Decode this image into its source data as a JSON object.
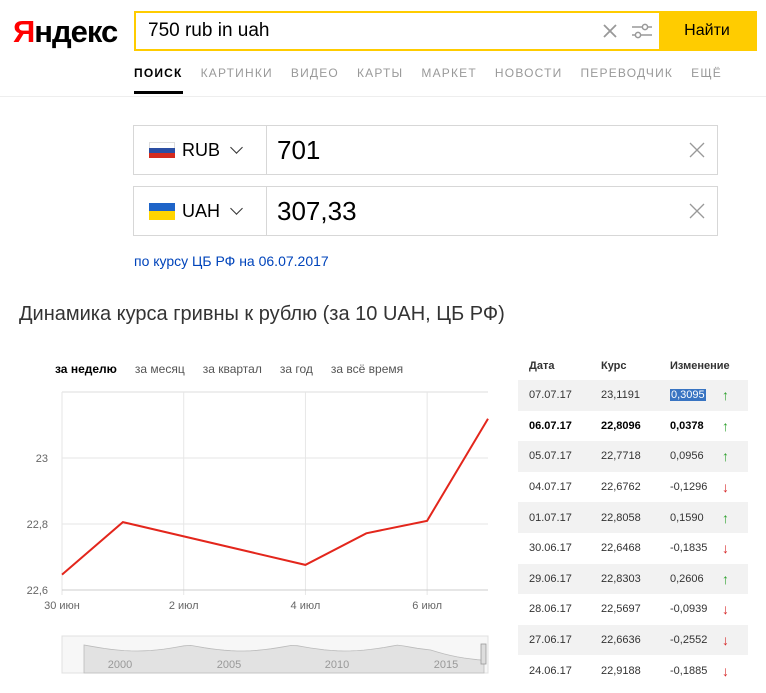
{
  "header": {
    "logo_first": "Я",
    "logo_rest": "ндекс",
    "search_value": "750 rub in uah",
    "search_button": "Найти"
  },
  "tabs": [
    {
      "label": "ПОИСК",
      "active": true
    },
    {
      "label": "КАРТИНКИ"
    },
    {
      "label": "ВИДЕО"
    },
    {
      "label": "КАРТЫ"
    },
    {
      "label": "МАРКЕТ"
    },
    {
      "label": "НОВОСТИ"
    },
    {
      "label": "ПЕРЕВОДЧИК"
    },
    {
      "label": "ЕЩЁ"
    }
  ],
  "converter": {
    "from": {
      "code": "RUB",
      "amount": "701"
    },
    "to": {
      "code": "UAH",
      "amount": "307,33"
    },
    "rate_note": "по курсу ЦБ РФ на 06.07.2017"
  },
  "chart_title": "Динамика курса гривны к рублю (за 10 UAH, ЦБ РФ)",
  "periods": [
    "за неделю",
    "за месяц",
    "за квартал",
    "за год",
    "за всё время"
  ],
  "chart_data": {
    "type": "line",
    "x": [
      "2017-06-30",
      "2017-07-01",
      "2017-07-04",
      "2017-07-05",
      "2017-07-06",
      "2017-07-07"
    ],
    "values": [
      22.6468,
      22.8058,
      22.6762,
      22.7718,
      22.8096,
      23.1191
    ],
    "x_tick_labels": [
      {
        "date": "2017-06-30",
        "label": "30 июн"
      },
      {
        "date": "2017-07-02",
        "label": "2 июл"
      },
      {
        "date": "2017-07-04",
        "label": "4 июл"
      },
      {
        "date": "2017-07-06",
        "label": "6 июл"
      }
    ],
    "y_ticks": [
      22.6,
      22.8,
      23
    ],
    "y_tick_labels": [
      "22,6",
      "22,8",
      "23"
    ],
    "ylim": [
      22.6,
      23.2
    ],
    "grid": true,
    "line_color": "#e3261c",
    "navigator_labels": [
      "2000",
      "2005",
      "2010",
      "2015"
    ]
  },
  "rate_table": {
    "headers": {
      "date": "Дата",
      "rate": "Курс",
      "change": "Изменение"
    },
    "rows": [
      {
        "date": "07.07.17",
        "rate": "23,1191",
        "change": "0,3095",
        "dir": "up",
        "highlight": true
      },
      {
        "date": "06.07.17",
        "rate": "22,8096",
        "change": "0,0378",
        "dir": "up",
        "bold": true
      },
      {
        "date": "05.07.17",
        "rate": "22,7718",
        "change": "0,0956",
        "dir": "up"
      },
      {
        "date": "04.07.17",
        "rate": "22,6762",
        "change": "-0,1296",
        "dir": "down"
      },
      {
        "date": "01.07.17",
        "rate": "22,8058",
        "change": "0,1590",
        "dir": "up"
      },
      {
        "date": "30.06.17",
        "rate": "22,6468",
        "change": "-0,1835",
        "dir": "down"
      },
      {
        "date": "29.06.17",
        "rate": "22,8303",
        "change": "0,2606",
        "dir": "up"
      },
      {
        "date": "28.06.17",
        "rate": "22,5697",
        "change": "-0,0939",
        "dir": "down"
      },
      {
        "date": "27.06.17",
        "rate": "22,6636",
        "change": "-0,2552",
        "dir": "down"
      },
      {
        "date": "24.06.17",
        "rate": "22,9188",
        "change": "-0,1885",
        "dir": "down"
      }
    ]
  },
  "colors": {
    "accent": "#ffcc00",
    "link": "#0044bb",
    "up": "#2ca02c",
    "down": "#d62728"
  }
}
